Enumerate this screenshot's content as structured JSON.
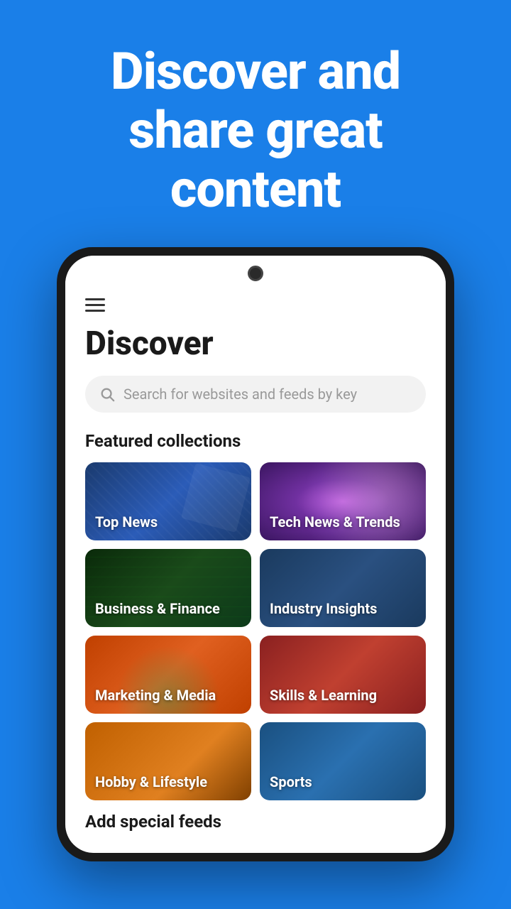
{
  "hero": {
    "title_line1": "Discover and",
    "title_line2": "share great",
    "title_line3": "content",
    "background_color": "#1a7fe8"
  },
  "app": {
    "page_title": "Discover",
    "search_placeholder": "Search for websites and feeds by key",
    "featured_section_label": "Featured collections",
    "add_feeds_label": "Add special feeds",
    "collections": [
      {
        "id": "top-news",
        "label": "Top News",
        "theme": "card-top-news"
      },
      {
        "id": "tech-news",
        "label": "Tech News & Trends",
        "theme": "card-tech-news"
      },
      {
        "id": "biz-finance",
        "label": "Business & Finance",
        "theme": "card-biz-finance"
      },
      {
        "id": "industry",
        "label": "Industry Insights",
        "theme": "card-industry"
      },
      {
        "id": "marketing",
        "label": "Marketing & Media",
        "theme": "card-marketing"
      },
      {
        "id": "skills",
        "label": "Skills & Learning",
        "theme": "card-skills"
      },
      {
        "id": "hobby",
        "label": "Hobby & Lifestyle",
        "theme": "card-hobby"
      },
      {
        "id": "sports",
        "label": "Sports",
        "theme": "card-sports"
      }
    ]
  }
}
